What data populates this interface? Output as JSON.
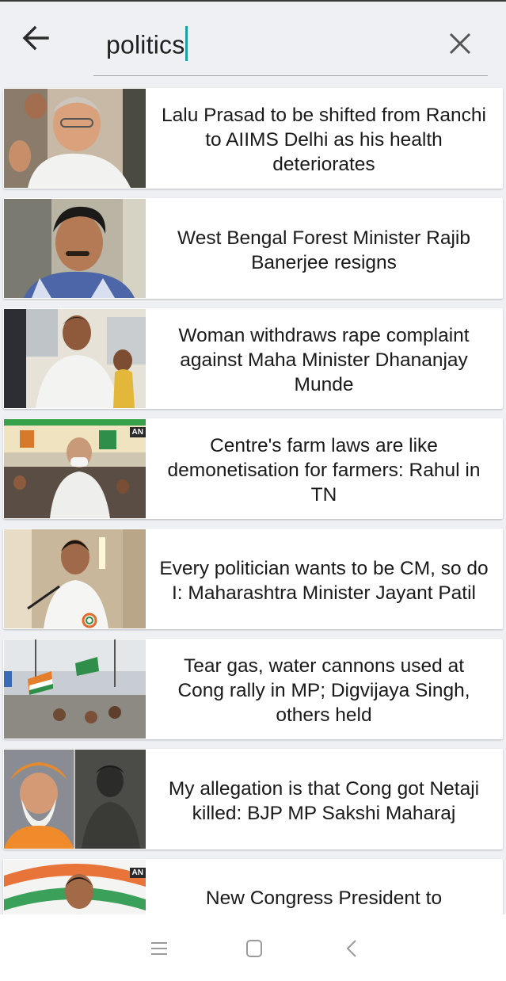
{
  "search": {
    "query": "politics"
  },
  "articles": [
    {
      "headline": "Lalu Prasad to be shifted from Ranchi to AIIMS Delhi as his health deteriorates"
    },
    {
      "headline": "West Bengal Forest Minister Rajib Banerjee resigns"
    },
    {
      "headline": "Woman withdraws rape complaint against Maha Minister Dhananjay Munde"
    },
    {
      "headline": "Centre's farm laws are like demonetisation for farmers: Rahul in TN",
      "badge": "AN"
    },
    {
      "headline": "Every politician wants to be CM, so do I: Maharashtra Minister Jayant Patil"
    },
    {
      "headline": "Tear gas, water cannons used at Cong rally in MP; Digvijaya Singh, others held"
    },
    {
      "headline": "My allegation is that Cong got Netaji killed: BJP MP Sakshi Maharaj"
    },
    {
      "headline": "New Congress President to",
      "badge": "AN"
    }
  ],
  "icons": {
    "back": "arrow-left-icon",
    "clear": "close-icon",
    "nav": [
      "menu-icon",
      "home-icon",
      "back-icon"
    ]
  },
  "colors": {
    "cursor": "#1aa3a0",
    "background": "#eef0f3",
    "card": "#ffffff"
  }
}
